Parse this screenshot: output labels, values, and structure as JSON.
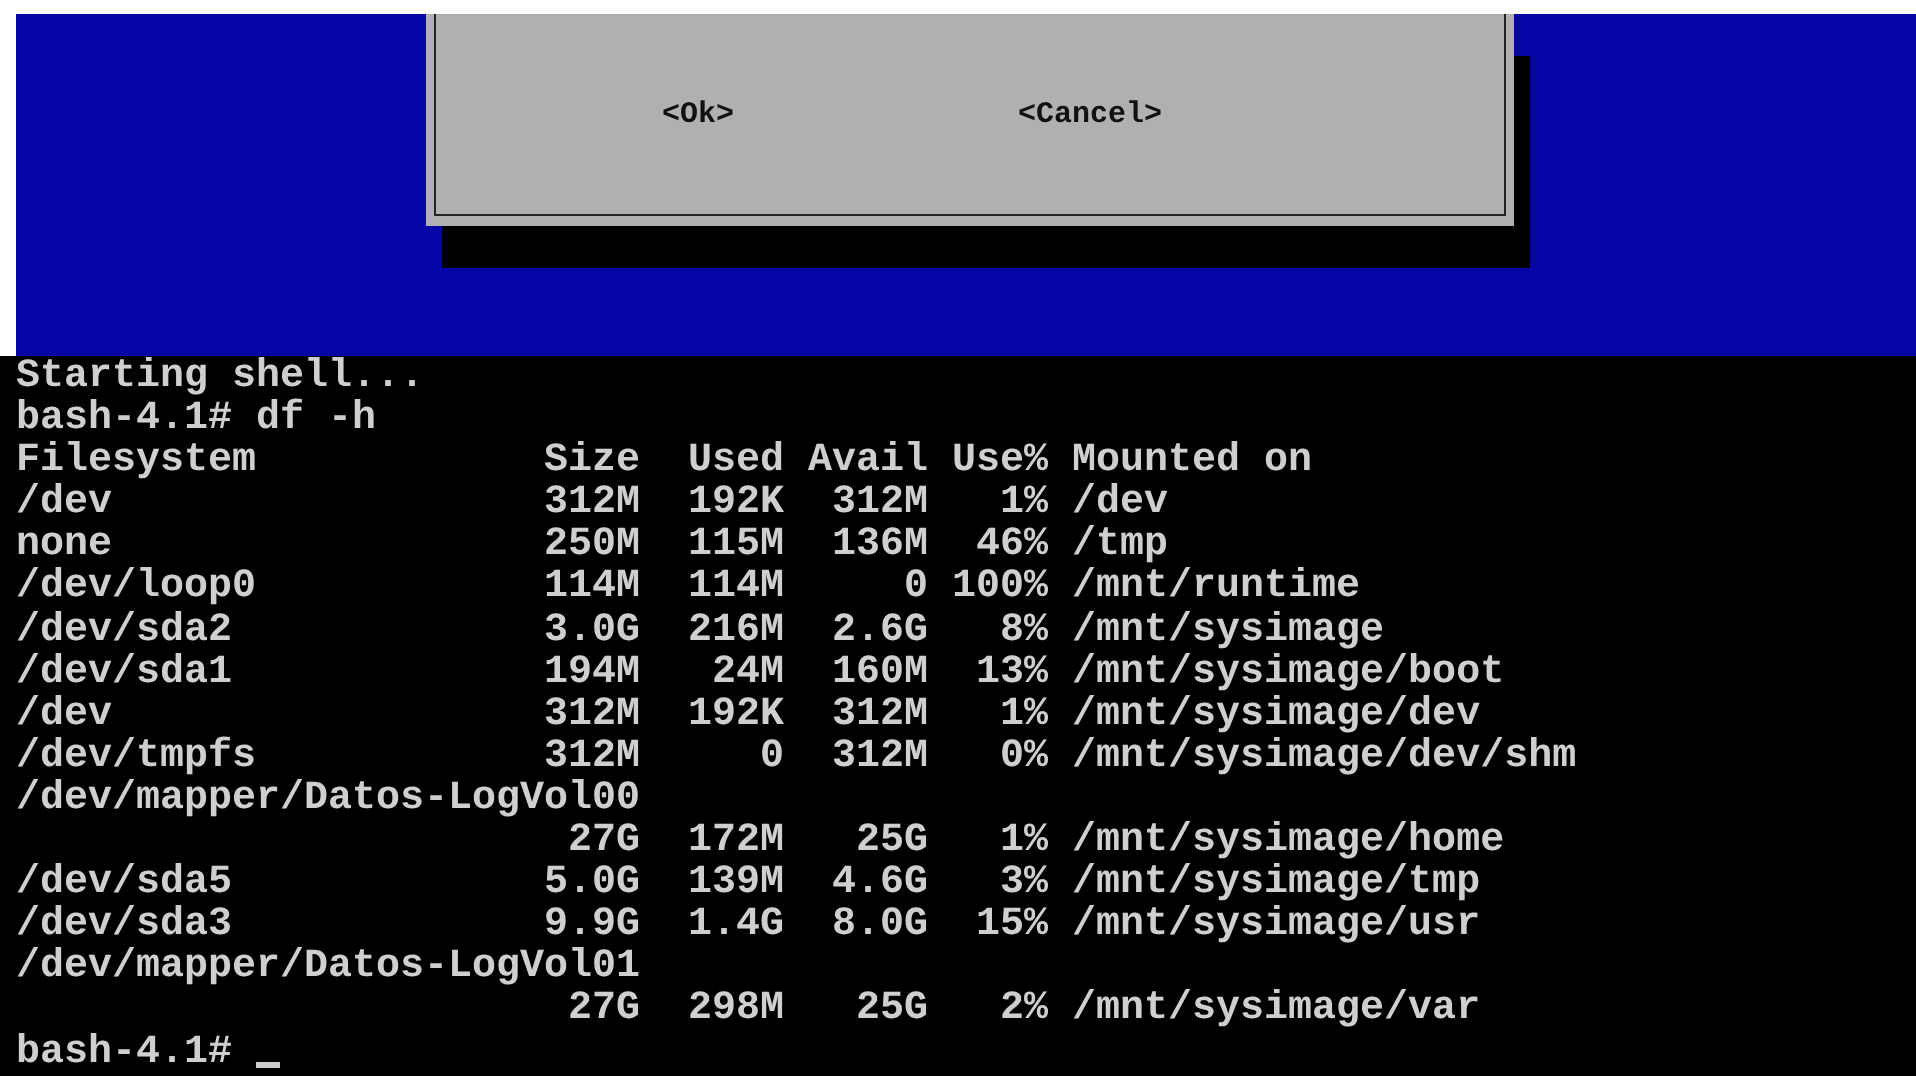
{
  "dialog": {
    "buttons": [
      {
        "label": "<Ok>"
      },
      {
        "label": "<Cancel>"
      }
    ]
  },
  "terminal": {
    "lines": [
      "Starting shell...",
      "bash-4.1# df -h"
    ],
    "header": [
      "Filesystem",
      "Size",
      "Used",
      "Avail",
      "Use%",
      "Mounted on"
    ],
    "rows": [
      {
        "filesystem": "/dev",
        "size": "312M",
        "used": "192K",
        "avail": "312M",
        "use": "1%",
        "mounted": "/dev"
      },
      {
        "filesystem": "none",
        "size": "250M",
        "used": "115M",
        "avail": "136M",
        "use": "46%",
        "mounted": "/tmp"
      },
      {
        "filesystem": "/dev/loop0",
        "size": "114M",
        "used": "114M",
        "avail": "0",
        "use": "100%",
        "mounted": "/mnt/runtime"
      },
      {
        "filesystem": "/dev/sda2",
        "size": "3.0G",
        "used": "216M",
        "avail": "2.6G",
        "use": "8%",
        "mounted": "/mnt/sysimage"
      },
      {
        "filesystem": "/dev/sda1",
        "size": "194M",
        "used": "24M",
        "avail": "160M",
        "use": "13%",
        "mounted": "/mnt/sysimage/boot"
      },
      {
        "filesystem": "/dev",
        "size": "312M",
        "used": "192K",
        "avail": "312M",
        "use": "1%",
        "mounted": "/mnt/sysimage/dev"
      },
      {
        "filesystem": "/dev/tmpfs",
        "size": "312M",
        "used": "0",
        "avail": "312M",
        "use": "0%",
        "mounted": "/mnt/sysimage/dev/shm"
      },
      {
        "filesystem": "/dev/mapper/Datos-LogVol00",
        "size": "27G",
        "used": "172M",
        "avail": "25G",
        "use": "1%",
        "mounted": "/mnt/sysimage/home"
      },
      {
        "filesystem": "/dev/sda5",
        "size": "5.0G",
        "used": "139M",
        "avail": "4.6G",
        "use": "3%",
        "mounted": "/mnt/sysimage/tmp"
      },
      {
        "filesystem": "/dev/sda3",
        "size": "9.9G",
        "used": "1.4G",
        "avail": "8.0G",
        "use": "15%",
        "mounted": "/mnt/sysimage/usr"
      },
      {
        "filesystem": "/dev/mapper/Datos-LogVol01",
        "size": "27G",
        "used": "298M",
        "avail": "25G",
        "use": "2%",
        "mounted": "/mnt/sysimage/var"
      }
    ],
    "prompt": "bash-4.1#"
  }
}
